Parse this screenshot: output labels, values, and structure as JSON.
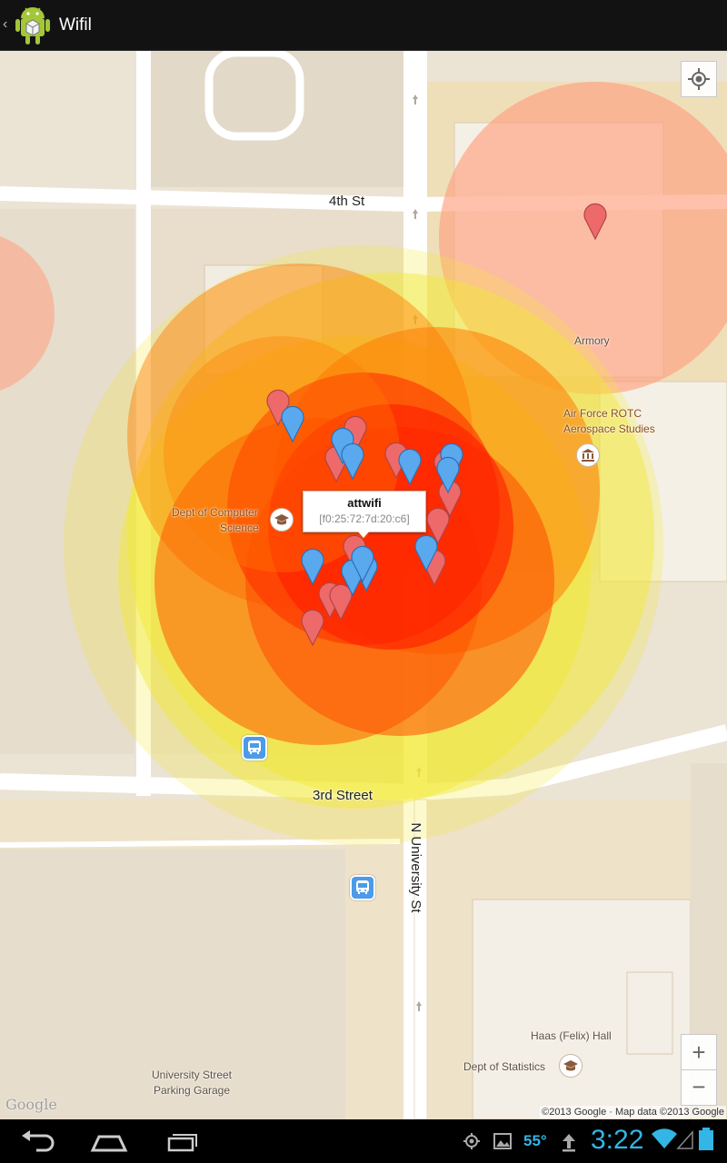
{
  "app": {
    "title": "Wifil",
    "up_caret": "‹"
  },
  "map": {
    "streets": {
      "fourth": "4th St",
      "third": "3rd Street",
      "university": "N University St"
    },
    "places": {
      "armory": "Armory",
      "rotc_line1": "Air Force ROTC",
      "rotc_line2": "Aerospace Studies",
      "cs_line1": "Dept of Computer",
      "cs_line2": "Science",
      "haas": "Haas (Felix) Hall",
      "statistics": "Dept of Statistics",
      "garage_line1": "University Street",
      "garage_line2": "Parking Garage"
    },
    "info_window": {
      "title": "attwifi",
      "subtitle": "[f0:25:72:7d:20:c6]"
    },
    "zoom_in_label": "+",
    "zoom_out_label": "−",
    "google_logo": "Google",
    "attribution": "©2013 Google · Map data ©2013 Google",
    "icons": [
      "my-location-icon",
      "university-icon",
      "museum-icon",
      "bus-stop-icon",
      "map-marker-icon"
    ],
    "colors": {
      "heat_red": "#ff1a00",
      "heat_orange": "#ff7a00",
      "heat_yellow": "#f2e832",
      "heat_salmon": "#ff9f80",
      "marker_red": "#ee6a6a",
      "marker_blue": "#5aa8ee"
    }
  },
  "status_bar": {
    "temperature": "55°",
    "time": "3:22"
  },
  "nav": {
    "icons": [
      "back-icon",
      "home-icon",
      "recent-apps-icon"
    ]
  }
}
